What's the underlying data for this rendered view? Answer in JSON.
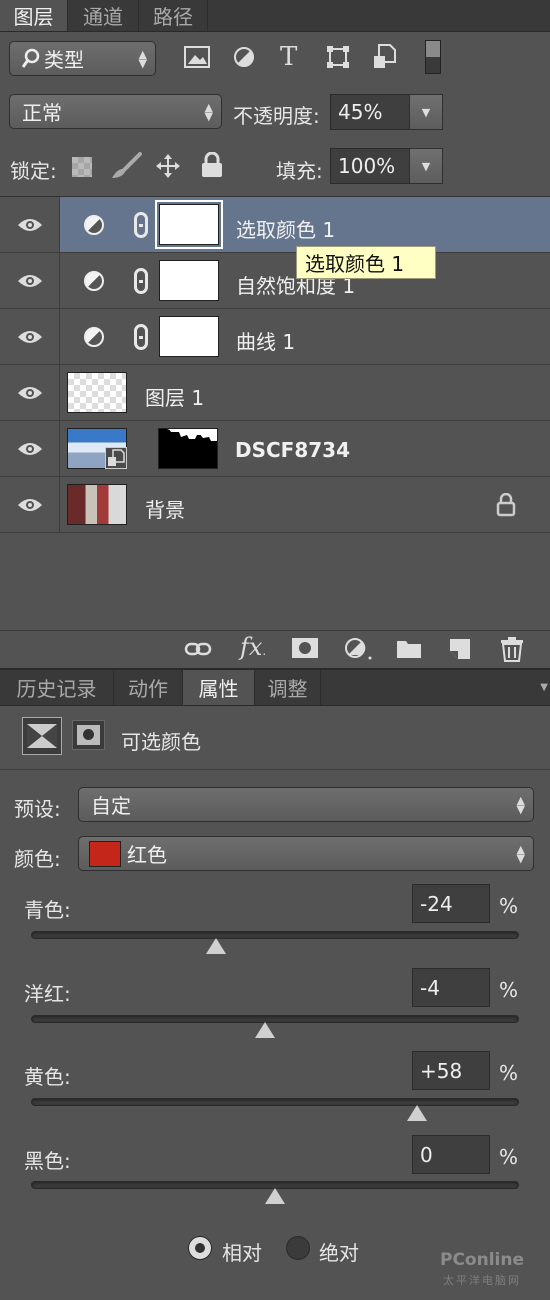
{
  "layers_panel": {
    "tabs": [
      "图层",
      "通道",
      "路径"
    ],
    "filter_label": "类型",
    "blend_mode": "正常",
    "opacity_label": "不透明度:",
    "opacity_value": "45%",
    "lock_label": "锁定:",
    "fill_label": "填充:",
    "fill_value": "100%",
    "layers": [
      {
        "name": "选取颜色 1",
        "type": "adjustment",
        "selected": true
      },
      {
        "name": "自然饱和度 1",
        "type": "adjustment"
      },
      {
        "name": "曲线 1",
        "type": "adjustment"
      },
      {
        "name": "图层 1",
        "type": "pixel"
      },
      {
        "name": "DSCF8734",
        "type": "smart-object-masked"
      },
      {
        "name": "背景",
        "type": "background",
        "locked": true
      }
    ],
    "tooltip": "选取颜色 1",
    "footer_icons": [
      "link-icon",
      "fx-icon",
      "mask-icon",
      "adjustment-icon",
      "folder-icon",
      "new-layer-icon",
      "trash-icon"
    ]
  },
  "properties_panel": {
    "tabs": [
      "历史记录",
      "动作",
      "属性",
      "调整"
    ],
    "title": "可选颜色",
    "preset_label": "预设:",
    "preset_value": "自定",
    "color_label": "颜色:",
    "color_value": "红色",
    "color_swatch": "#c4261a",
    "sliders": [
      {
        "label": "青色:",
        "value": "-24",
        "percent": -24
      },
      {
        "label": "洋红:",
        "value": "-4",
        "percent": -4
      },
      {
        "label": "黄色:",
        "value": "+58",
        "percent": 58
      },
      {
        "label": "黑色:",
        "value": "0",
        "percent": 0
      }
    ],
    "pct_sign": "%",
    "method_relative": "相对",
    "method_absolute": "绝对",
    "selected_method": "相对"
  },
  "watermark": {
    "brand": "PConline",
    "sub": "太平洋电脑网"
  }
}
